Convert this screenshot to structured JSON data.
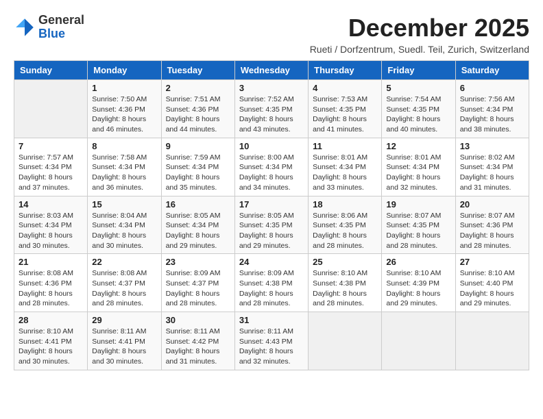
{
  "header": {
    "logo_general": "General",
    "logo_blue": "Blue",
    "month_title": "December 2025",
    "subtitle": "Rueti / Dorfzentrum, Suedl. Teil, Zurich, Switzerland"
  },
  "days_of_week": [
    "Sunday",
    "Monday",
    "Tuesday",
    "Wednesday",
    "Thursday",
    "Friday",
    "Saturday"
  ],
  "weeks": [
    [
      {
        "day": "",
        "info": ""
      },
      {
        "day": "1",
        "info": "Sunrise: 7:50 AM\nSunset: 4:36 PM\nDaylight: 8 hours\nand 46 minutes."
      },
      {
        "day": "2",
        "info": "Sunrise: 7:51 AM\nSunset: 4:36 PM\nDaylight: 8 hours\nand 44 minutes."
      },
      {
        "day": "3",
        "info": "Sunrise: 7:52 AM\nSunset: 4:35 PM\nDaylight: 8 hours\nand 43 minutes."
      },
      {
        "day": "4",
        "info": "Sunrise: 7:53 AM\nSunset: 4:35 PM\nDaylight: 8 hours\nand 41 minutes."
      },
      {
        "day": "5",
        "info": "Sunrise: 7:54 AM\nSunset: 4:35 PM\nDaylight: 8 hours\nand 40 minutes."
      },
      {
        "day": "6",
        "info": "Sunrise: 7:56 AM\nSunset: 4:34 PM\nDaylight: 8 hours\nand 38 minutes."
      }
    ],
    [
      {
        "day": "7",
        "info": "Sunrise: 7:57 AM\nSunset: 4:34 PM\nDaylight: 8 hours\nand 37 minutes."
      },
      {
        "day": "8",
        "info": "Sunrise: 7:58 AM\nSunset: 4:34 PM\nDaylight: 8 hours\nand 36 minutes."
      },
      {
        "day": "9",
        "info": "Sunrise: 7:59 AM\nSunset: 4:34 PM\nDaylight: 8 hours\nand 35 minutes."
      },
      {
        "day": "10",
        "info": "Sunrise: 8:00 AM\nSunset: 4:34 PM\nDaylight: 8 hours\nand 34 minutes."
      },
      {
        "day": "11",
        "info": "Sunrise: 8:01 AM\nSunset: 4:34 PM\nDaylight: 8 hours\nand 33 minutes."
      },
      {
        "day": "12",
        "info": "Sunrise: 8:01 AM\nSunset: 4:34 PM\nDaylight: 8 hours\nand 32 minutes."
      },
      {
        "day": "13",
        "info": "Sunrise: 8:02 AM\nSunset: 4:34 PM\nDaylight: 8 hours\nand 31 minutes."
      }
    ],
    [
      {
        "day": "14",
        "info": "Sunrise: 8:03 AM\nSunset: 4:34 PM\nDaylight: 8 hours\nand 30 minutes."
      },
      {
        "day": "15",
        "info": "Sunrise: 8:04 AM\nSunset: 4:34 PM\nDaylight: 8 hours\nand 30 minutes."
      },
      {
        "day": "16",
        "info": "Sunrise: 8:05 AM\nSunset: 4:34 PM\nDaylight: 8 hours\nand 29 minutes."
      },
      {
        "day": "17",
        "info": "Sunrise: 8:05 AM\nSunset: 4:35 PM\nDaylight: 8 hours\nand 29 minutes."
      },
      {
        "day": "18",
        "info": "Sunrise: 8:06 AM\nSunset: 4:35 PM\nDaylight: 8 hours\nand 28 minutes."
      },
      {
        "day": "19",
        "info": "Sunrise: 8:07 AM\nSunset: 4:35 PM\nDaylight: 8 hours\nand 28 minutes."
      },
      {
        "day": "20",
        "info": "Sunrise: 8:07 AM\nSunset: 4:36 PM\nDaylight: 8 hours\nand 28 minutes."
      }
    ],
    [
      {
        "day": "21",
        "info": "Sunrise: 8:08 AM\nSunset: 4:36 PM\nDaylight: 8 hours\nand 28 minutes."
      },
      {
        "day": "22",
        "info": "Sunrise: 8:08 AM\nSunset: 4:37 PM\nDaylight: 8 hours\nand 28 minutes."
      },
      {
        "day": "23",
        "info": "Sunrise: 8:09 AM\nSunset: 4:37 PM\nDaylight: 8 hours\nand 28 minutes."
      },
      {
        "day": "24",
        "info": "Sunrise: 8:09 AM\nSunset: 4:38 PM\nDaylight: 8 hours\nand 28 minutes."
      },
      {
        "day": "25",
        "info": "Sunrise: 8:10 AM\nSunset: 4:38 PM\nDaylight: 8 hours\nand 28 minutes."
      },
      {
        "day": "26",
        "info": "Sunrise: 8:10 AM\nSunset: 4:39 PM\nDaylight: 8 hours\nand 29 minutes."
      },
      {
        "day": "27",
        "info": "Sunrise: 8:10 AM\nSunset: 4:40 PM\nDaylight: 8 hours\nand 29 minutes."
      }
    ],
    [
      {
        "day": "28",
        "info": "Sunrise: 8:10 AM\nSunset: 4:41 PM\nDaylight: 8 hours\nand 30 minutes."
      },
      {
        "day": "29",
        "info": "Sunrise: 8:11 AM\nSunset: 4:41 PM\nDaylight: 8 hours\nand 30 minutes."
      },
      {
        "day": "30",
        "info": "Sunrise: 8:11 AM\nSunset: 4:42 PM\nDaylight: 8 hours\nand 31 minutes."
      },
      {
        "day": "31",
        "info": "Sunrise: 8:11 AM\nSunset: 4:43 PM\nDaylight: 8 hours\nand 32 minutes."
      },
      {
        "day": "",
        "info": ""
      },
      {
        "day": "",
        "info": ""
      },
      {
        "day": "",
        "info": ""
      }
    ]
  ]
}
